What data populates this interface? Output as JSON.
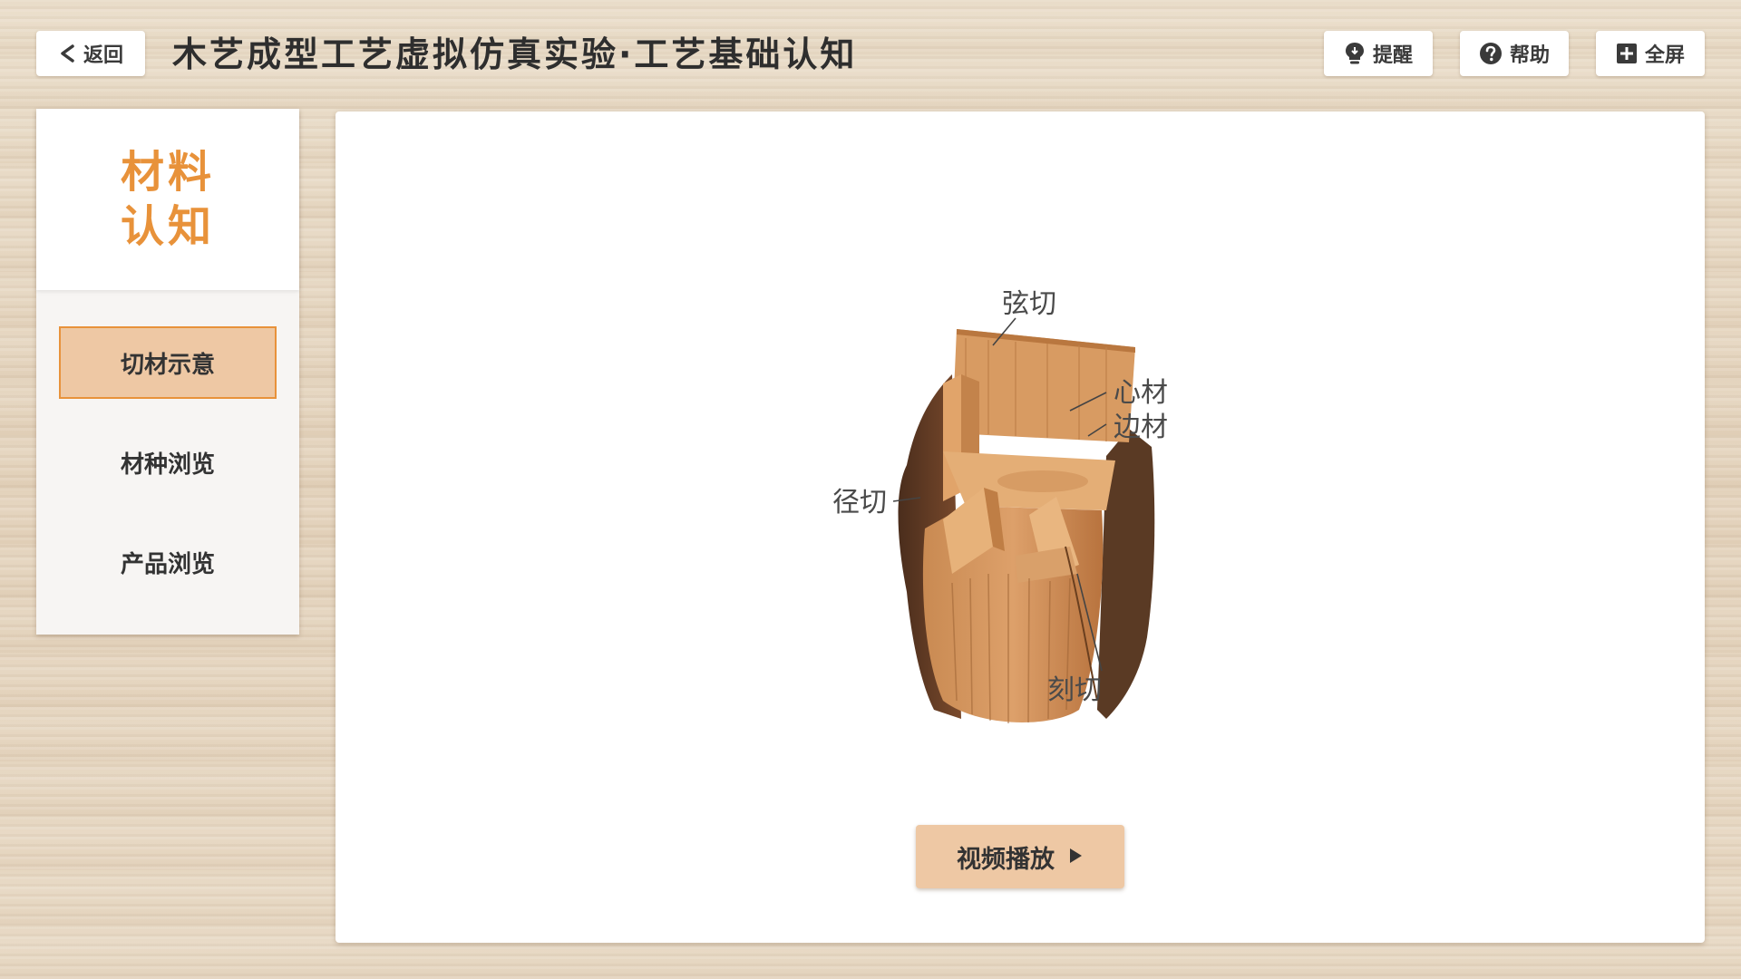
{
  "header": {
    "back_label": "返回",
    "title": "木艺成型工艺虚拟仿真实验·工艺基础认知",
    "hint_label": "提醒",
    "help_label": "帮助",
    "fullscreen_label": "全屏"
  },
  "sidebar": {
    "heading_line1": "材料",
    "heading_line2": "认知",
    "accent_color": "#e8923a",
    "active_bg": "#eec8a4",
    "items": [
      {
        "label": "切材示意",
        "active": true
      },
      {
        "label": "材种浏览",
        "active": false
      },
      {
        "label": "产品浏览",
        "active": false
      }
    ]
  },
  "figure": {
    "labels": {
      "tangential": "弦切",
      "heartwood": "心材",
      "sapwood": "边材",
      "radial": "径切",
      "rift": "刻切"
    }
  },
  "video_button": {
    "label": "视频播放",
    "icon": "play-icon"
  },
  "icons": {
    "back": "chevron-left-icon",
    "hint": "lightbulb-icon",
    "help": "question-circle-icon",
    "fullscreen": "expand-icon"
  }
}
